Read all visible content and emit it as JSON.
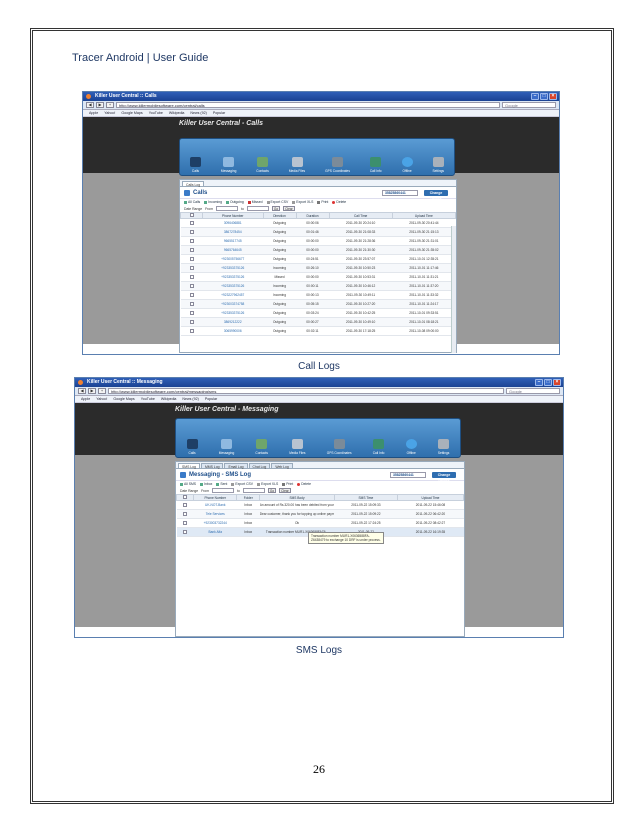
{
  "header": {
    "text": "Tracer Android | User Guide"
  },
  "captions": {
    "calls": "Call Logs",
    "sms": "SMS Logs"
  },
  "page_number": "26",
  "browser": {
    "calls_title": "Killer User Central :: Calls",
    "calls_url": "http://www.killermobilesoftware.com/central/calls",
    "sms_title": "Killer User Central :: Messaging",
    "sms_url": "http://www.killermobilesoftware.com/central/messaging/sms",
    "search_placeholder": "Google",
    "bookmarks": [
      "Apple",
      "Yahoo!",
      "Google Maps",
      "YouTube",
      "Wikipedia",
      "News (92)",
      "Popular"
    ]
  },
  "site": {
    "calls_heading": "Killer User Central - Calls",
    "sms_heading": "Killer User Central - Messaging",
    "toolbar": [
      "Calls",
      "Messaging",
      "Contacts",
      "Media Files",
      "GPS Coordinates",
      "Call Info",
      "Offline",
      "Settings"
    ]
  },
  "calls_panel": {
    "tabs": [
      "Calls Log"
    ],
    "title": "Calls",
    "device": "35825860441",
    "change_device": "Change Device",
    "filters": [
      "All Calls",
      "Incoming",
      "Outgoing",
      "Missed",
      "Export CSV",
      "Export XLS",
      "Print",
      "Delete"
    ],
    "date_range_label": "Date Range",
    "from_label": "From",
    "to_label": "to",
    "go_label": "Go",
    "clear_label": "Clear",
    "columns": [
      "",
      "Phone Number",
      "Direction",
      "Duration",
      "Call Time",
      "Upload Time"
    ],
    "rows": [
      [
        "",
        "3096406881",
        "Outgoing",
        "00:00:06",
        "2011-09-30 20:24:10",
        "2011-09-30 20:41:44"
      ],
      [
        "",
        "3867278454",
        "Outgoing",
        "00:01:46",
        "2011-09-30 21:08:33",
        "2011-09-30 21:15:13"
      ],
      [
        "",
        "9665517745",
        "Outgoing",
        "00:00:00",
        "2011-09-30 21:28:36",
        "2011-09-30 21:31:01"
      ],
      [
        "",
        "9665764645",
        "Outgoing",
        "00:00:00",
        "2011-09-30 21:30:30",
        "2011-09-30 21:35:02"
      ],
      [
        "",
        "+923005756677",
        "Outgoing",
        "00:24:51",
        "2011-09-30 23:57:07",
        "2011-10-01 12:35:21"
      ],
      [
        "",
        "+923353375126",
        "Incoming",
        "00:26:10",
        "2011-09-30 10:50:23",
        "2011-10-01 11:17:46"
      ],
      [
        "",
        "+923353375126",
        "Missed",
        "00:00:00",
        "2011-09-30 10:53:31",
        "2011-10-01 11:31:21"
      ],
      [
        "",
        "+923353375126",
        "Incoming",
        "00:00:11",
        "2011-09-30 10:46:12",
        "2011-10-01 11:37:20"
      ],
      [
        "",
        "+923227962457",
        "Incoming",
        "00:00:13",
        "2011-09-30 10:49:11",
        "2011-10-01 11:33:32"
      ],
      [
        "",
        "+923003374758",
        "Outgoing",
        "00:05:15",
        "2011-09-30 10:27:20",
        "2011-10-01 11:24:17"
      ],
      [
        "",
        "+923353375126",
        "Outgoing",
        "00:03:24",
        "2011-09-30 10:42:25",
        "2011-10-01 09:33:51"
      ],
      [
        "",
        "3869212222",
        "Outgoing",
        "00:00:27",
        "2011-09-30 10:49:10",
        "2011-10-01 08:18:21"
      ],
      [
        "",
        "3065990006",
        "Outgoing",
        "00:02:11",
        "2011-09-30 17:18:25",
        "2011-10-08 09:00:00"
      ]
    ]
  },
  "sms_panel": {
    "tabs": [
      "SMS Log",
      "MMS Log",
      "Email Log",
      "Chat Log",
      "Web Log"
    ],
    "title": "Messaging - SMS Log",
    "device": "35825860441",
    "change_device": "Change Device",
    "filters": [
      "All SMS",
      "Inbox",
      "Sent",
      "Export CSV",
      "Export XLS",
      "Print",
      "Delete"
    ],
    "date_range_label": "Date Range",
    "from_label": "From",
    "to_label": "to",
    "go_label": "Go",
    "clear_label": "Clear",
    "columns": [
      "",
      "Phone Number",
      "Folder",
      "SMS Body",
      "SMS Time",
      "Upload Time"
    ],
    "rows": [
      [
        "",
        "UK-NOT-Bank",
        "Inbox",
        "An amount of Rs.320.00 has been debited from your acc",
        "2011-09-22 15:09:33",
        "2011-09-22 15:46:08"
      ],
      [
        "",
        "Tele Services",
        "Inbox",
        "Dear customer, thank you for topping up online payment",
        "2011-09-22 15:09:22",
        "2011-09-22 06:42:20"
      ],
      [
        "",
        "+923003732244",
        "Inbox",
        "Ok",
        "2011-09-22 17:24:25",
        "2011-09-22 08:42:27"
      ],
      [
        "",
        "Bank Alfa",
        "Inbox",
        "Transaction number MUR1-X063658FAZ6...",
        "2011-09-22",
        "2011-09-22 16:19:35"
      ]
    ],
    "tooltip": "Transaction number MUR1-X0636588FA-Z6438479 to exchange 10 DRF is under process."
  }
}
